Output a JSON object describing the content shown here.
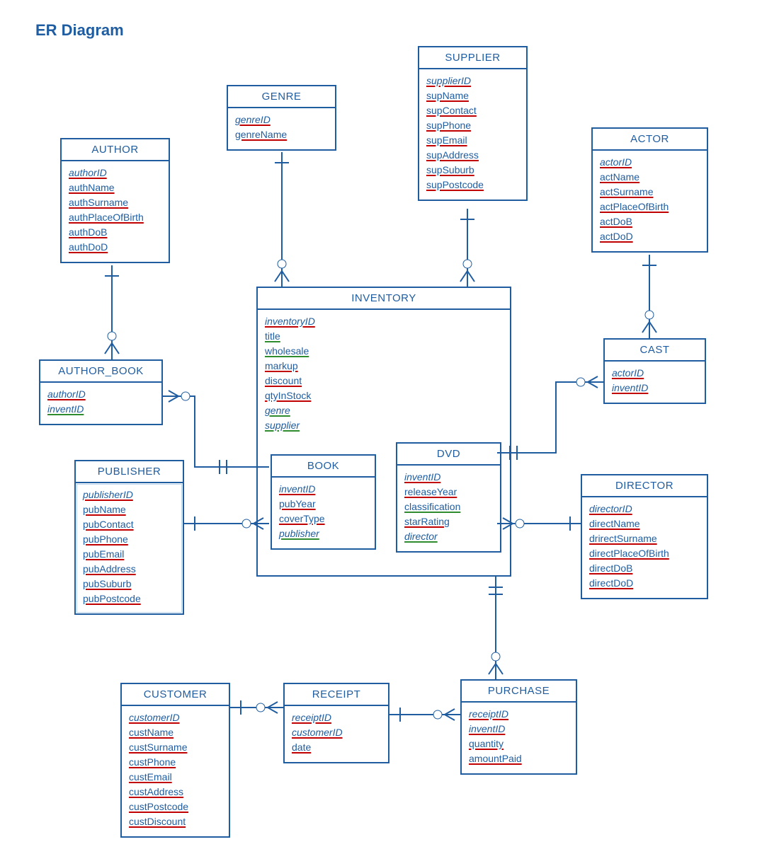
{
  "title": "ER Diagram",
  "entities": {
    "author": {
      "name": "AUTHOR",
      "attrs": [
        "authorID",
        "authName",
        "authSurname",
        "authPlaceOfBirth",
        "authDoB",
        "authDoD"
      ]
    },
    "genre": {
      "name": "GENRE",
      "attrs": [
        "genreID",
        "genreName"
      ]
    },
    "supplier": {
      "name": "SUPPLIER",
      "attrs": [
        "supplierID",
        "supName",
        "supContact",
        "supPhone",
        "supEmail",
        "supAddress",
        "supSuburb",
        "supPostcode"
      ]
    },
    "actor": {
      "name": "ACTOR",
      "attrs": [
        "actorID",
        "actName",
        "actSurname",
        "actPlaceOfBirth",
        "actDoB",
        "actDoD"
      ]
    },
    "author_book": {
      "name": "AUTHOR_BOOK",
      "attrs": [
        "authorID",
        "inventID"
      ]
    },
    "inventory": {
      "name": "INVENTORY",
      "attrs": [
        "inventoryID",
        "title",
        "wholesale",
        "markup",
        "discount",
        "qtyInStock",
        "genre",
        "supplier"
      ]
    },
    "book": {
      "name": "BOOK",
      "attrs": [
        "inventID",
        "pubYear",
        "coverType",
        "publisher"
      ]
    },
    "dvd": {
      "name": "DVD",
      "attrs": [
        "inventID",
        "releaseYear",
        "classification",
        "starRating",
        "director"
      ]
    },
    "cast": {
      "name": "CAST",
      "attrs": [
        "actorID",
        "inventID"
      ]
    },
    "publisher": {
      "name": "PUBLISHER",
      "attrs": [
        "publisherID",
        "pubName",
        "pubContact",
        "pubPhone",
        "pubEmail",
        "pubAddress",
        "pubSuburb",
        "pubPostcode"
      ]
    },
    "director": {
      "name": "DIRECTOR",
      "attrs": [
        "directorID",
        "directName",
        "drirectSurname",
        "directPlaceOfBirth",
        "directDoB",
        "directDoD"
      ]
    },
    "customer": {
      "name": "CUSTOMER",
      "attrs": [
        "customerID",
        "custName",
        "custSurname",
        "custPhone",
        "custEmail",
        "custAddress",
        "custPostcode",
        "custDiscount"
      ]
    },
    "receipt": {
      "name": "RECEIPT",
      "attrs": [
        "receiptID",
        "customerID",
        "date"
      ]
    },
    "purchase": {
      "name": "PURCHASE",
      "attrs": [
        "receiptID",
        "inventID",
        "quantity",
        "amountPaid"
      ]
    }
  },
  "chart_data": {
    "type": "er-diagram",
    "entities": [
      {
        "name": "AUTHOR",
        "attributes": [
          "authorID",
          "authName",
          "authSurname",
          "authPlaceOfBirth",
          "authDoB",
          "authDoD"
        ],
        "primary_key": [
          "authorID"
        ]
      },
      {
        "name": "GENRE",
        "attributes": [
          "genreID",
          "genreName"
        ],
        "primary_key": [
          "genreID"
        ]
      },
      {
        "name": "SUPPLIER",
        "attributes": [
          "supplierID",
          "supName",
          "supContact",
          "supPhone",
          "supEmail",
          "supAddress",
          "supSuburb",
          "supPostcode"
        ],
        "primary_key": [
          "supplierID"
        ]
      },
      {
        "name": "ACTOR",
        "attributes": [
          "actorID",
          "actName",
          "actSurname",
          "actPlaceOfBirth",
          "actDoB",
          "actDoD"
        ],
        "primary_key": [
          "actorID"
        ]
      },
      {
        "name": "AUTHOR_BOOK",
        "attributes": [
          "authorID",
          "inventID"
        ],
        "foreign_keys": [
          "authorID",
          "inventID"
        ]
      },
      {
        "name": "INVENTORY",
        "attributes": [
          "inventoryID",
          "title",
          "wholesale",
          "markup",
          "discount",
          "qtyInStock",
          "genre",
          "supplier"
        ],
        "primary_key": [
          "inventoryID"
        ],
        "foreign_keys": [
          "genre",
          "supplier"
        ]
      },
      {
        "name": "BOOK",
        "attributes": [
          "inventID",
          "pubYear",
          "coverType",
          "publisher"
        ],
        "foreign_keys": [
          "inventID",
          "publisher"
        ]
      },
      {
        "name": "DVD",
        "attributes": [
          "inventID",
          "releaseYear",
          "classification",
          "starRating",
          "director"
        ],
        "foreign_keys": [
          "inventID",
          "director"
        ]
      },
      {
        "name": "CAST",
        "attributes": [
          "actorID",
          "inventID"
        ],
        "foreign_keys": [
          "actorID",
          "inventID"
        ]
      },
      {
        "name": "PUBLISHER",
        "attributes": [
          "publisherID",
          "pubName",
          "pubContact",
          "pubPhone",
          "pubEmail",
          "pubAddress",
          "pubSuburb",
          "pubPostcode"
        ],
        "primary_key": [
          "publisherID"
        ]
      },
      {
        "name": "DIRECTOR",
        "attributes": [
          "directorID",
          "directName",
          "drirectSurname",
          "directPlaceOfBirth",
          "directDoB",
          "directDoD"
        ],
        "primary_key": [
          "directorID"
        ]
      },
      {
        "name": "CUSTOMER",
        "attributes": [
          "customerID",
          "custName",
          "custSurname",
          "custPhone",
          "custEmail",
          "custAddress",
          "custPostcode",
          "custDiscount"
        ],
        "primary_key": [
          "customerID"
        ]
      },
      {
        "name": "RECEIPT",
        "attributes": [
          "receiptID",
          "customerID",
          "date"
        ],
        "primary_key": [
          "receiptID"
        ],
        "foreign_keys": [
          "customerID"
        ]
      },
      {
        "name": "PURCHASE",
        "attributes": [
          "receiptID",
          "inventID",
          "quantity",
          "amountPaid"
        ],
        "foreign_keys": [
          "receiptID",
          "inventID"
        ]
      }
    ],
    "relationships": [
      {
        "from": "AUTHOR",
        "to": "AUTHOR_BOOK",
        "cardinality": "1..*"
      },
      {
        "from": "AUTHOR_BOOK",
        "to": "BOOK",
        "cardinality": "*..1"
      },
      {
        "from": "GENRE",
        "to": "INVENTORY",
        "cardinality": "1..*"
      },
      {
        "from": "SUPPLIER",
        "to": "INVENTORY",
        "cardinality": "1..*"
      },
      {
        "from": "ACTOR",
        "to": "CAST",
        "cardinality": "1..*"
      },
      {
        "from": "CAST",
        "to": "DVD",
        "cardinality": "*..1"
      },
      {
        "from": "PUBLISHER",
        "to": "BOOK",
        "cardinality": "1..*"
      },
      {
        "from": "DIRECTOR",
        "to": "DVD",
        "cardinality": "1..*"
      },
      {
        "from": "INVENTORY",
        "to": "PURCHASE",
        "cardinality": "1..*"
      },
      {
        "from": "PURCHASE",
        "to": "RECEIPT",
        "cardinality": "*..1"
      },
      {
        "from": "RECEIPT",
        "to": "CUSTOMER",
        "cardinality": "*..1"
      }
    ]
  }
}
